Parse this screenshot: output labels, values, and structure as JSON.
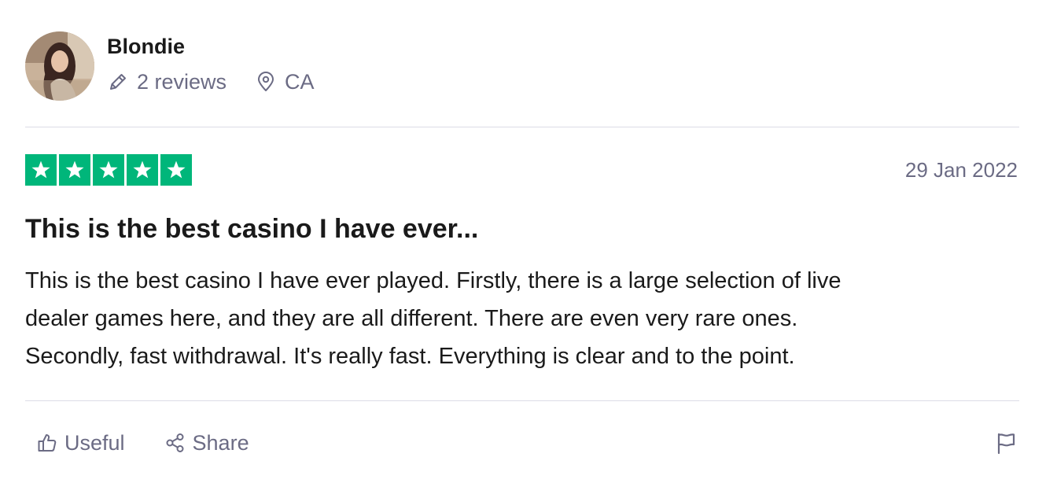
{
  "consumer": {
    "name": "Blondie",
    "reviews_count": "2 reviews",
    "country": "CA"
  },
  "review": {
    "rating": 5,
    "rating_color": "#00b67a",
    "date": "29 Jan 2022",
    "title": "This is the best casino I have ever...",
    "text_lines": [
      "This is the best casino I have ever played. Firstly, there is a large selection of live",
      "dealer games here, and they are all different. There are even very rare ones.",
      "Secondly, fast withdrawal. It's really fast. Everything is clear and to the point."
    ]
  },
  "actions": {
    "useful_label": "Useful",
    "share_label": "Share"
  },
  "icons": {
    "reviews": "pencil-icon",
    "location": "map-pin-icon",
    "useful": "thumbs-up-icon",
    "share": "share-icon",
    "report": "flag-icon"
  }
}
